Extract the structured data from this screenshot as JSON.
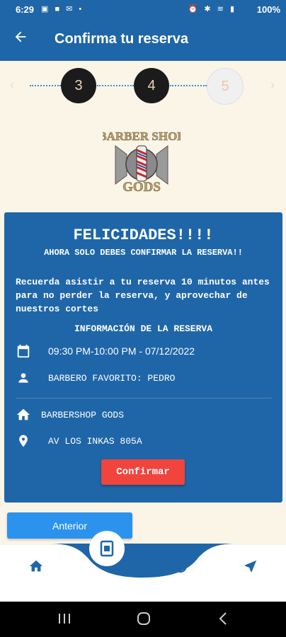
{
  "status_bar": {
    "time": "6:29",
    "battery": "100%"
  },
  "app_bar": {
    "title": "Confirma tu reserva"
  },
  "stepper": {
    "steps": [
      "3",
      "4",
      "5"
    ]
  },
  "card": {
    "heading": "FELICIDADES!!!!",
    "subheading": "AHORA SOLO DEBES CONFIRMAR LA RESERVA!!",
    "message": "Recuerda asistir a tu reserva 10 minutos antes para no perder la reserva, y aprovechar de nuestros cortes",
    "info_title": "INFORMACIÓN DE LA RESERVA",
    "schedule": "09:30 PM-10:00 PM  - 07/12/2022",
    "barber": "BARBERO FAVORITO: PEDRO",
    "shop": "BARBERSHOP GODS",
    "address": "AV LOS INKAS 805A",
    "confirm_label": "Confirmar"
  },
  "prev_label": "Anterior",
  "colors": {
    "primary": "#1f66a8",
    "confirm": "#f0443d",
    "prev": "#2b93ee",
    "background": "#fbf5e8"
  },
  "icons": {
    "app_bar": "back-arrow-icon",
    "card": [
      "calendar-icon",
      "person-icon",
      "home-icon",
      "location-pin-icon"
    ],
    "bottom_nav": [
      "home-icon",
      "calendar-icon",
      "history-icon",
      "navigation-icon"
    ],
    "system_nav": [
      "recent-apps-icon",
      "home-circle-icon",
      "back-chevron-icon"
    ]
  }
}
